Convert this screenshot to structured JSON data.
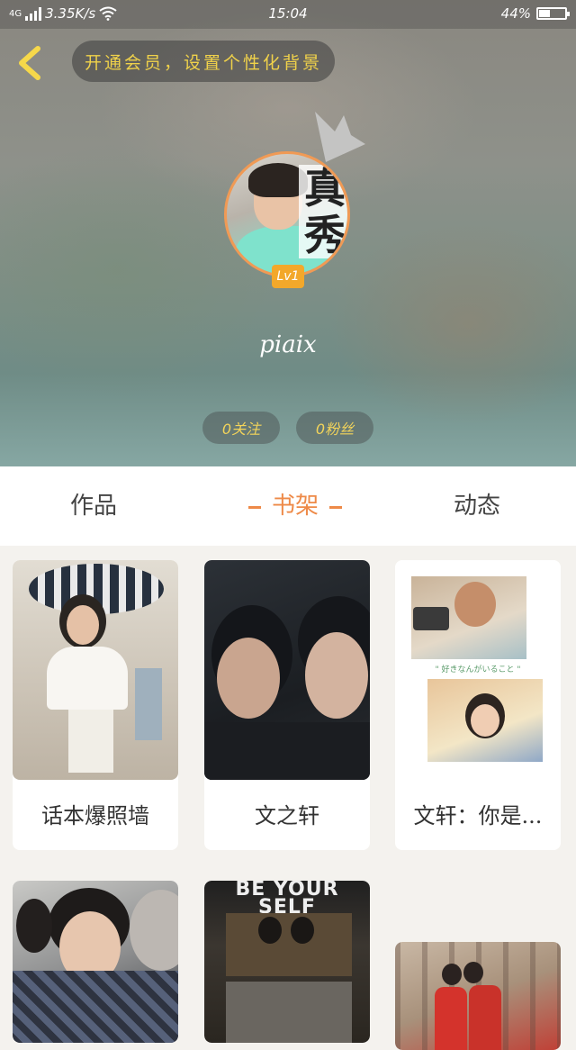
{
  "status_bar": {
    "network": "4G",
    "speed": "3.35K/s",
    "time": "15:04",
    "battery": "44%",
    "battery_level": 0.44
  },
  "header": {
    "vip_banner": "开通会员，设置个性化背景"
  },
  "profile": {
    "avatar_text": "真秀",
    "level": "Lv1",
    "username": "piaix",
    "follow": "0关注",
    "fans": "0粉丝"
  },
  "tabs": [
    {
      "label": "作品"
    },
    {
      "label": "书架"
    },
    {
      "label": "动态"
    }
  ],
  "active_tab": "书架",
  "shelf": [
    {
      "title": "话本爆照墙"
    },
    {
      "title": "文之轩"
    },
    {
      "title": "文轩：你是..."
    },
    {
      "title": ""
    },
    {
      "title": ""
    },
    {
      "title": ""
    }
  ],
  "cover_texts": {
    "book3_caption": "\" 好きなんがいること \"",
    "book5_banner": "BE YOUR SELF"
  },
  "colors": {
    "accent": "#ee8a48",
    "vip_text": "#f0d24a",
    "level_badge": "#f3a82a"
  }
}
